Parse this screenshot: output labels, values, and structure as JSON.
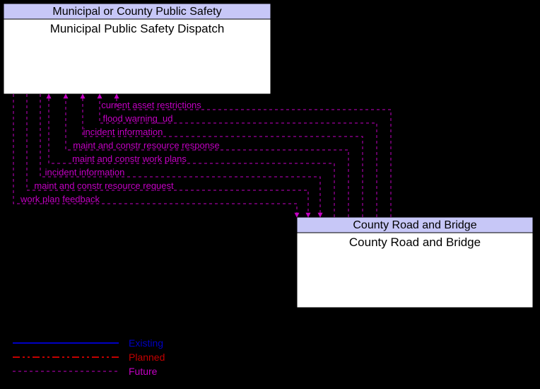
{
  "boxes": {
    "top": {
      "header": "Municipal or County Public Safety",
      "body": "Municipal Public Safety Dispatch"
    },
    "bottom": {
      "header": "County Road and Bridge",
      "body": "County Road and Bridge"
    }
  },
  "flows": {
    "to_top": [
      "current asset restrictions",
      "flood warning_ud",
      "incident information",
      "maint and constr resource response",
      "maint and constr work plans"
    ],
    "to_bottom": [
      "incident information",
      "maint and constr resource request",
      "work plan feedback"
    ]
  },
  "legend": {
    "existing": "Existing",
    "planned": "Planned",
    "future": "Future"
  },
  "chart_data": {
    "type": "diagram",
    "title": "",
    "nodes": [
      {
        "id": "mpsd",
        "label": "Municipal Public Safety Dispatch",
        "group": "Municipal or County Public Safety"
      },
      {
        "id": "crb",
        "label": "County Road and Bridge",
        "group": "County Road and Bridge"
      }
    ],
    "edges": [
      {
        "from": "crb",
        "to": "mpsd",
        "label": "current asset restrictions",
        "status": "Future"
      },
      {
        "from": "crb",
        "to": "mpsd",
        "label": "flood warning_ud",
        "status": "Future"
      },
      {
        "from": "crb",
        "to": "mpsd",
        "label": "incident information",
        "status": "Future"
      },
      {
        "from": "crb",
        "to": "mpsd",
        "label": "maint and constr resource response",
        "status": "Future"
      },
      {
        "from": "crb",
        "to": "mpsd",
        "label": "maint and constr work plans",
        "status": "Future"
      },
      {
        "from": "mpsd",
        "to": "crb",
        "label": "incident information",
        "status": "Future"
      },
      {
        "from": "mpsd",
        "to": "crb",
        "label": "maint and constr resource request",
        "status": "Future"
      },
      {
        "from": "mpsd",
        "to": "crb",
        "label": "work plan feedback",
        "status": "Future"
      }
    ],
    "legend": [
      "Existing",
      "Planned",
      "Future"
    ]
  }
}
